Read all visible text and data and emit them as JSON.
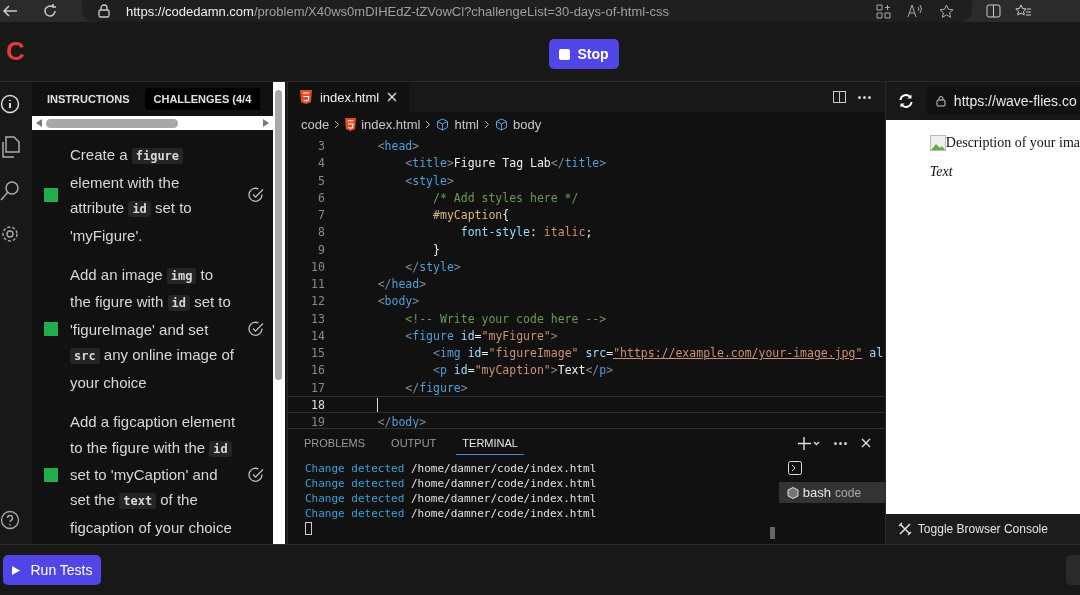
{
  "browser": {
    "url_host": "https://codedamn.com",
    "url_path": "/problem/X40ws0mDIHEdZ-tZVowCl?challengeList=30-days-of-html-css"
  },
  "header": {
    "logo": "C",
    "stop_button": "Stop"
  },
  "instructions": {
    "tabs": [
      {
        "label": "INSTRUCTIONS",
        "selected": false
      },
      {
        "label": "CHALLENGES (4/4",
        "selected": true
      }
    ],
    "challenges": [
      {
        "completed": true,
        "parts": [
          {
            "kind": "text",
            "text": "Create a "
          },
          {
            "kind": "code",
            "text": "figure"
          },
          {
            "kind": "text",
            "text": " element with the attribute "
          },
          {
            "kind": "code",
            "text": "id"
          },
          {
            "kind": "text",
            "text": " set to 'myFigure'."
          }
        ]
      },
      {
        "completed": true,
        "parts": [
          {
            "kind": "text",
            "text": "Add an image "
          },
          {
            "kind": "code",
            "text": "img"
          },
          {
            "kind": "text",
            "text": " to the figure with "
          },
          {
            "kind": "code",
            "text": "id"
          },
          {
            "kind": "text",
            "text": " set to 'figureImage' and set "
          },
          {
            "kind": "code",
            "text": "src"
          },
          {
            "kind": "text",
            "text": " any online image of your choice"
          }
        ]
      },
      {
        "completed": true,
        "parts": [
          {
            "kind": "text",
            "text": "Add a figcaption element to the figure with the "
          },
          {
            "kind": "code",
            "text": "id"
          },
          {
            "kind": "text",
            "text": " set to 'myCaption' and set the "
          },
          {
            "kind": "code",
            "text": "text"
          },
          {
            "kind": "text",
            "text": " of the figcaption of your choice"
          }
        ]
      }
    ]
  },
  "editor": {
    "tab": "index.html",
    "breadcrumb": [
      "code",
      "index.html",
      "html",
      "body"
    ],
    "lines": [
      {
        "number": "3",
        "current": false,
        "tokens": [
          {
            "kind": "punct",
            "text": "    <"
          },
          {
            "kind": "tag",
            "text": "head"
          },
          {
            "kind": "punct",
            "text": ">"
          }
        ]
      },
      {
        "number": "4",
        "current": false,
        "tokens": [
          {
            "kind": "punct",
            "text": "        <"
          },
          {
            "kind": "tag",
            "text": "title"
          },
          {
            "kind": "punct",
            "text": ">"
          },
          {
            "kind": "text",
            "text": "Figure Tag Lab"
          },
          {
            "kind": "punct",
            "text": "</"
          },
          {
            "kind": "tag",
            "text": "title"
          },
          {
            "kind": "punct",
            "text": ">"
          }
        ]
      },
      {
        "number": "5",
        "current": false,
        "tokens": [
          {
            "kind": "punct",
            "text": "        <"
          },
          {
            "kind": "tag",
            "text": "style"
          },
          {
            "kind": "punct",
            "text": ">"
          }
        ]
      },
      {
        "number": "6",
        "current": false,
        "tokens": [
          {
            "kind": "comment",
            "text": "            /* Add styles here */"
          }
        ]
      },
      {
        "number": "7",
        "current": false,
        "tokens": [
          {
            "kind": "selector",
            "text": "            #myCaption"
          },
          {
            "kind": "text",
            "text": "{"
          }
        ]
      },
      {
        "number": "8",
        "current": false,
        "tokens": [
          {
            "kind": "attr",
            "text": "                font-style"
          },
          {
            "kind": "text",
            "text": ": "
          },
          {
            "kind": "string",
            "text": "italic"
          },
          {
            "kind": "text",
            "text": ";"
          }
        ]
      },
      {
        "number": "9",
        "current": false,
        "tokens": [
          {
            "kind": "text",
            "text": "            }"
          }
        ]
      },
      {
        "number": "10",
        "current": false,
        "tokens": [
          {
            "kind": "punct",
            "text": "        </"
          },
          {
            "kind": "tag",
            "text": "style"
          },
          {
            "kind": "punct",
            "text": ">"
          }
        ]
      },
      {
        "number": "11",
        "current": false,
        "tokens": [
          {
            "kind": "punct",
            "text": "    </"
          },
          {
            "kind": "tag",
            "text": "head"
          },
          {
            "kind": "punct",
            "text": ">"
          }
        ]
      },
      {
        "number": "12",
        "current": false,
        "tokens": [
          {
            "kind": "punct",
            "text": "    <"
          },
          {
            "kind": "tag",
            "text": "body"
          },
          {
            "kind": "punct",
            "text": ">"
          }
        ]
      },
      {
        "number": "13",
        "current": false,
        "tokens": [
          {
            "kind": "comment",
            "text": "        <!-- Write your code here -->"
          }
        ]
      },
      {
        "number": "14",
        "current": false,
        "tokens": [
          {
            "kind": "punct",
            "text": "        <"
          },
          {
            "kind": "tag",
            "text": "figure"
          },
          {
            "kind": "attr",
            "text": " id"
          },
          {
            "kind": "text",
            "text": "="
          },
          {
            "kind": "string",
            "text": "\"myFigure\""
          },
          {
            "kind": "punct",
            "text": ">"
          }
        ]
      },
      {
        "number": "15",
        "current": false,
        "tokens": [
          {
            "kind": "punct",
            "text": "            <"
          },
          {
            "kind": "tag",
            "text": "img"
          },
          {
            "kind": "attr",
            "text": " id"
          },
          {
            "kind": "text",
            "text": "="
          },
          {
            "kind": "string",
            "text": "\"figureImage\""
          },
          {
            "kind": "attr",
            "text": " src"
          },
          {
            "kind": "text",
            "text": "="
          },
          {
            "kind": "link",
            "text": "\"https://example.com/your-image.jpg\""
          },
          {
            "kind": "attr",
            "text": " al"
          }
        ]
      },
      {
        "number": "16",
        "current": false,
        "tokens": [
          {
            "kind": "punct",
            "text": "            <"
          },
          {
            "kind": "tag",
            "text": "p"
          },
          {
            "kind": "attr",
            "text": " id"
          },
          {
            "kind": "text",
            "text": "="
          },
          {
            "kind": "string",
            "text": "\"myCaption\""
          },
          {
            "kind": "punct",
            "text": ">"
          },
          {
            "kind": "text",
            "text": "Text"
          },
          {
            "kind": "punct",
            "text": "</"
          },
          {
            "kind": "tag",
            "text": "p"
          },
          {
            "kind": "punct",
            "text": ">"
          }
        ]
      },
      {
        "number": "17",
        "current": false,
        "tokens": [
          {
            "kind": "punct",
            "text": "        </"
          },
          {
            "kind": "tag",
            "text": "figure"
          },
          {
            "kind": "punct",
            "text": ">"
          }
        ]
      },
      {
        "number": "18",
        "current": true
      },
      {
        "number": "19",
        "current": false,
        "tokens": [
          {
            "kind": "punct",
            "text": "    </"
          },
          {
            "kind": "tag",
            "text": "body"
          },
          {
            "kind": "punct",
            "text": ">"
          }
        ]
      }
    ]
  },
  "panel": {
    "tabs": [
      {
        "label": "PROBLEMS",
        "selected": false
      },
      {
        "label": "OUTPUT",
        "selected": false
      },
      {
        "label": "TERMINAL",
        "selected": true
      }
    ],
    "terminal": [
      {
        "label": "Change detected",
        "path": "/home/damner/code/index.html"
      },
      {
        "label": "Change detected",
        "path": "/home/damner/code/index.html"
      },
      {
        "label": "Change detected",
        "path": "/home/damner/code/index.html"
      },
      {
        "label": "Change detected",
        "path": "/home/damner/code/index.html"
      }
    ],
    "session": {
      "name": "bash",
      "folder": "code"
    }
  },
  "preview": {
    "url": "https://wave-flies.co",
    "image_alt": "Description of your ima",
    "caption": "Text",
    "console_button": "Toggle Browser Console"
  },
  "footer": {
    "run_button": "Run Tests"
  }
}
